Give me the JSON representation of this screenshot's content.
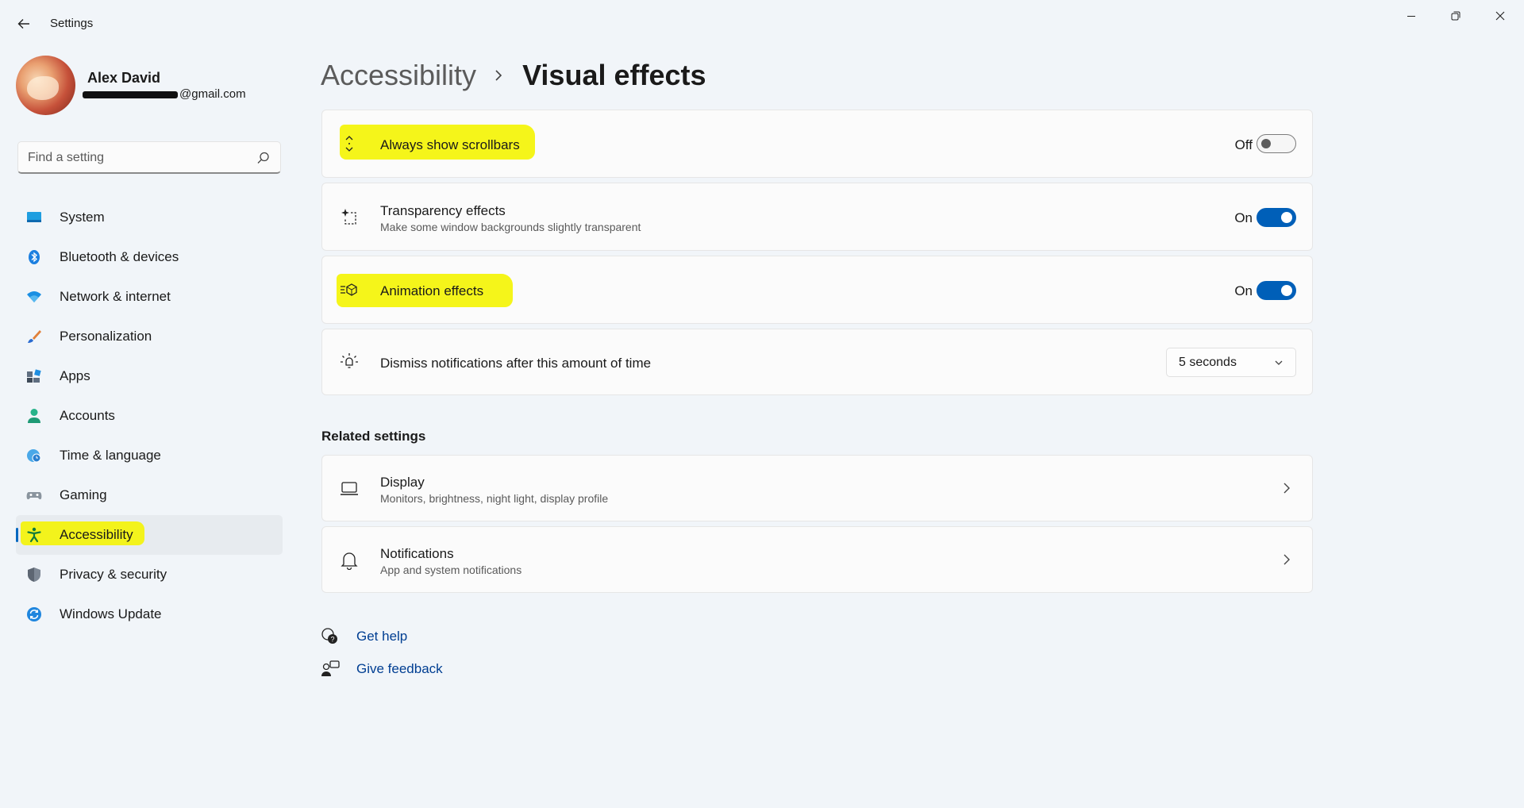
{
  "window": {
    "title": "Settings"
  },
  "profile": {
    "name": "Alex David",
    "email_visible_suffix": "@gmail.com"
  },
  "search": {
    "placeholder": "Find a setting"
  },
  "nav": {
    "items": [
      {
        "label": "System",
        "icon": "monitor-icon"
      },
      {
        "label": "Bluetooth & devices",
        "icon": "bluetooth-icon"
      },
      {
        "label": "Network & internet",
        "icon": "wifi-icon"
      },
      {
        "label": "Personalization",
        "icon": "brush-icon"
      },
      {
        "label": "Apps",
        "icon": "apps-icon"
      },
      {
        "label": "Accounts",
        "icon": "person-icon"
      },
      {
        "label": "Time & language",
        "icon": "globe-clock-icon"
      },
      {
        "label": "Gaming",
        "icon": "gamepad-icon"
      },
      {
        "label": "Accessibility",
        "icon": "accessibility-icon",
        "active": true
      },
      {
        "label": "Privacy & security",
        "icon": "shield-icon"
      },
      {
        "label": "Windows Update",
        "icon": "update-icon"
      }
    ]
  },
  "breadcrumb": {
    "parent": "Accessibility",
    "current": "Visual effects"
  },
  "settings": {
    "scrollbars": {
      "title": "Always show scrollbars",
      "state": "Off"
    },
    "transparency": {
      "title": "Transparency effects",
      "subtitle": "Make some window backgrounds slightly transparent",
      "state": "On"
    },
    "animation": {
      "title": "Animation effects",
      "state": "On"
    },
    "notifications_timeout": {
      "title": "Dismiss notifications after this amount of time",
      "value": "5 seconds"
    }
  },
  "related": {
    "title": "Related settings",
    "display": {
      "title": "Display",
      "subtitle": "Monitors, brightness, night light, display profile"
    },
    "notifications": {
      "title": "Notifications",
      "subtitle": "App and system notifications"
    }
  },
  "links": {
    "help": "Get help",
    "feedback": "Give feedback"
  },
  "colors": {
    "accent": "#005fb8",
    "highlight": "#f5f51a",
    "background": "#f1f5f9"
  }
}
